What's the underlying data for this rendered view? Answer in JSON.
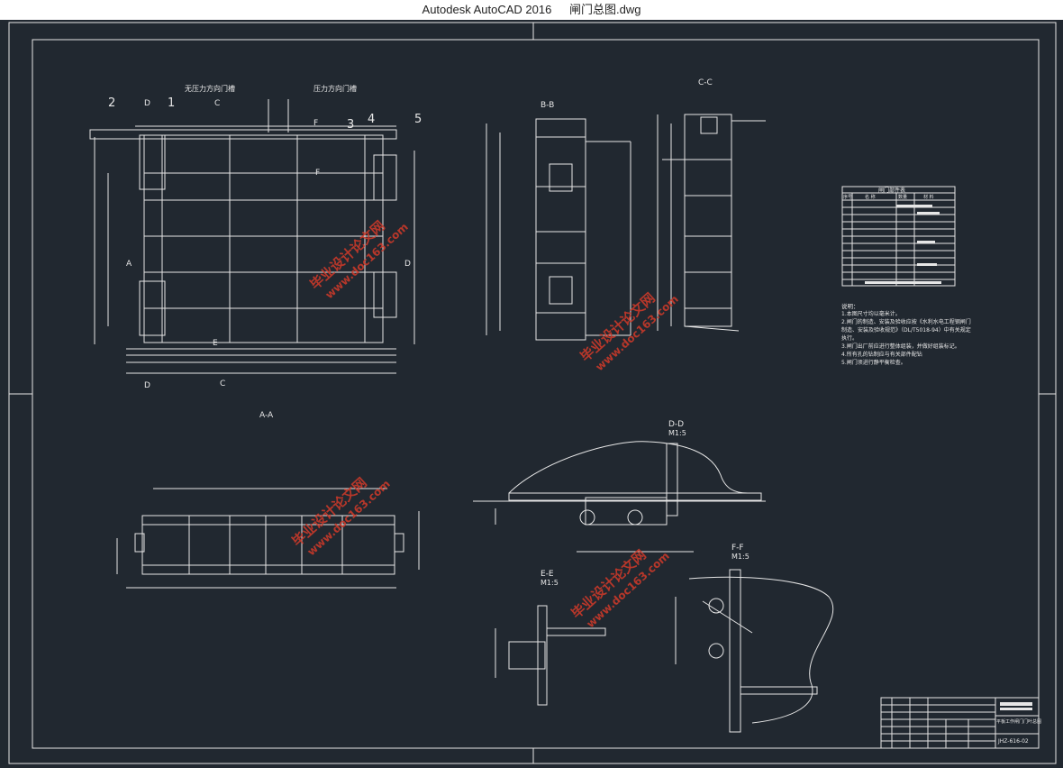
{
  "window": {
    "app_title": "Autodesk AutoCAD 2016",
    "file_name": "闸门总图.dwg"
  },
  "drawing": {
    "section_labels": {
      "aa": "A-A",
      "bb": "B-B",
      "cc": "C-C",
      "dd": "D-D",
      "dd_scale": "M1:5",
      "ee": "E-E",
      "ee_scale": "M1:5",
      "ff": "F-F",
      "ff_scale": "M1:5"
    },
    "plan_labels": {
      "left_note": "无压力方向门槽",
      "right_note": "压力方向门槽",
      "callouts": [
        "2",
        "1",
        "3",
        "4",
        "5"
      ],
      "cut_marks": [
        "D",
        "C",
        "F",
        "F",
        "A",
        "E",
        "D",
        "D",
        "C"
      ]
    },
    "table_title": "闸门部件表",
    "table_header": [
      "序号",
      "名 称",
      "数量",
      "材 料"
    ],
    "notes_title": "说明：",
    "notes": [
      "1.本图尺寸均以毫米计。",
      "2.闸门的制造、安装及验收应按《水利水电工程钢闸门",
      "制造、安装及验收规范》（DL/T5018-94）中有关规定",
      "执行。",
      "3.闸门出厂前应进行整体组装，并做好组装标记。",
      "4.所有孔的钻制应与有关部件配钻",
      "5.闸门须进行静平衡检查。"
    ],
    "title_block": {
      "drawing_title": "平板工作闸门门叶总图",
      "drawing_no": "JHZ-616-02"
    },
    "watermark": {
      "line1": "毕业设计论文网",
      "line2": "www.doc163.com"
    }
  }
}
